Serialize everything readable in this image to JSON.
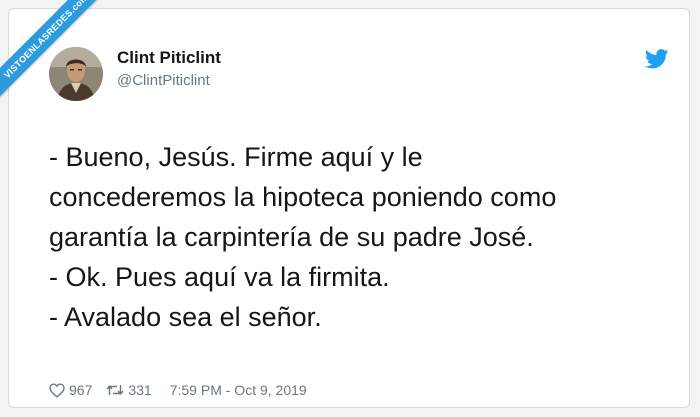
{
  "watermark": {
    "text": "VISTOENLASREDES.com"
  },
  "author": {
    "name": "Clint Piticlint",
    "handle": "@ClintPiticlint",
    "avatar_icon": "avatar-portrait"
  },
  "brand": {
    "icon": "twitter-bird-icon",
    "color": "#1da1f2"
  },
  "tweet": {
    "lines": [
      "- Bueno, Jesús. Firme aquí y le",
      "concederemos la hipoteca poniendo como",
      "garantía la carpintería de su padre José.",
      "- Ok. Pues aquí va la firmita.",
      "- Avalado sea el señor."
    ]
  },
  "stats": {
    "likes": "967",
    "retweets": "331",
    "timestamp": "7:59 PM - Oct 9, 2019"
  },
  "colors": {
    "text": "#14171a",
    "secondary": "#657786",
    "ribbon": "#2d9be0"
  }
}
